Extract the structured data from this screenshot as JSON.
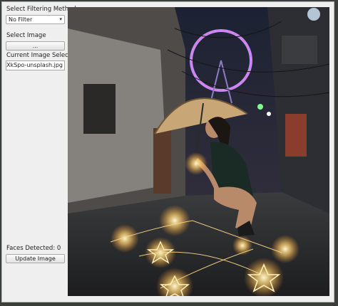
{
  "controls": {
    "filter_label": "Select Filtering Method",
    "filter_value": "No Filter",
    "select_image_label": "Select Image",
    "browse_button": "...",
    "current_image_label": "Current Image Selected",
    "current_image_value": "zoHALXkSpo-unsplash.jpg",
    "faces_detected": "Faces Detected: 0",
    "update_button": "Update Image"
  },
  "icons": {
    "combo_arrow": "chevron-down-icon"
  }
}
